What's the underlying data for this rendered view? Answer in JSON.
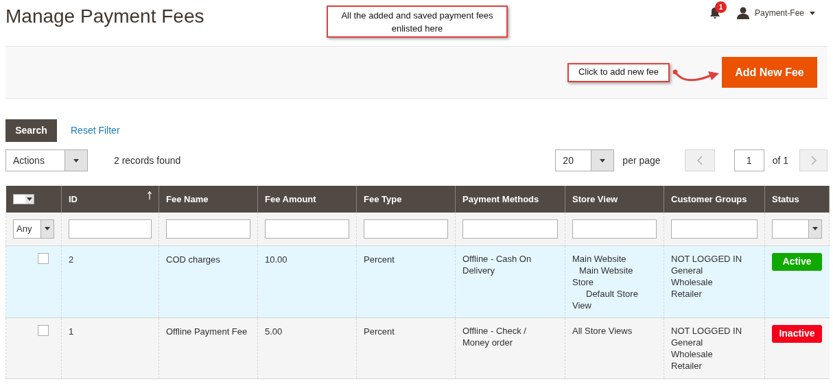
{
  "page_title": "Manage Payment Fees",
  "annotations": [
    {
      "kind": "top",
      "text": "All the added and saved payment fees enlisted here"
    },
    {
      "kind": "arrow",
      "text": "Click to add new fee"
    }
  ],
  "header": {
    "notification_count": "1",
    "user": "Payment-Fee"
  },
  "add_button": "Add New Fee",
  "search_button": "Search",
  "reset_link": "Reset Filter",
  "actions_select": "Actions",
  "records_found": "2 records found",
  "per_page_select": "20",
  "per_page_label": "per page",
  "page_input": "1",
  "page_total": "of 1",
  "table": {
    "columns": [
      {
        "label": "ID",
        "sorted": true
      },
      {
        "label": "Fee Name",
        "sorted": false
      },
      {
        "label": "Fee Amount",
        "sorted": false
      },
      {
        "label": "Fee Type",
        "sorted": false
      },
      {
        "label": "Payment Methods",
        "sorted": false
      },
      {
        "label": "Store View",
        "sorted": false
      },
      {
        "label": "Customer Groups",
        "sorted": false
      },
      {
        "label": "Status",
        "sorted": false
      }
    ],
    "any_filter": "Any",
    "rows": [
      {
        "selected": true,
        "checked": false,
        "id": "2",
        "fee_name": "COD charges",
        "fee_amount": "10.00",
        "fee_type": "Percent",
        "payment_methods": "Offline - Cash On Delivery",
        "store_view": [
          {
            "label": "Main Website",
            "children": [
              {
                "label": "Main Website Store",
                "children": [
                  {
                    "label": "Default Store View"
                  }
                ]
              }
            ]
          }
        ],
        "customer_groups": [
          "NOT LOGGED IN",
          "General",
          "Wholesale",
          "Retailer"
        ],
        "status": {
          "label": "Active",
          "active": true
        }
      },
      {
        "selected": false,
        "checked": false,
        "id": "1",
        "fee_name": "Offline Payment Fee",
        "fee_amount": "5.00",
        "fee_type": "Percent",
        "payment_methods": "Offline - Check / Money order",
        "store_view": [
          {
            "label": "All Store Views"
          }
        ],
        "customer_groups": [
          "NOT LOGGED IN",
          "General",
          "Wholesale",
          "Retailer"
        ],
        "status": {
          "label": "Inactive",
          "active": false
        }
      }
    ]
  }
}
